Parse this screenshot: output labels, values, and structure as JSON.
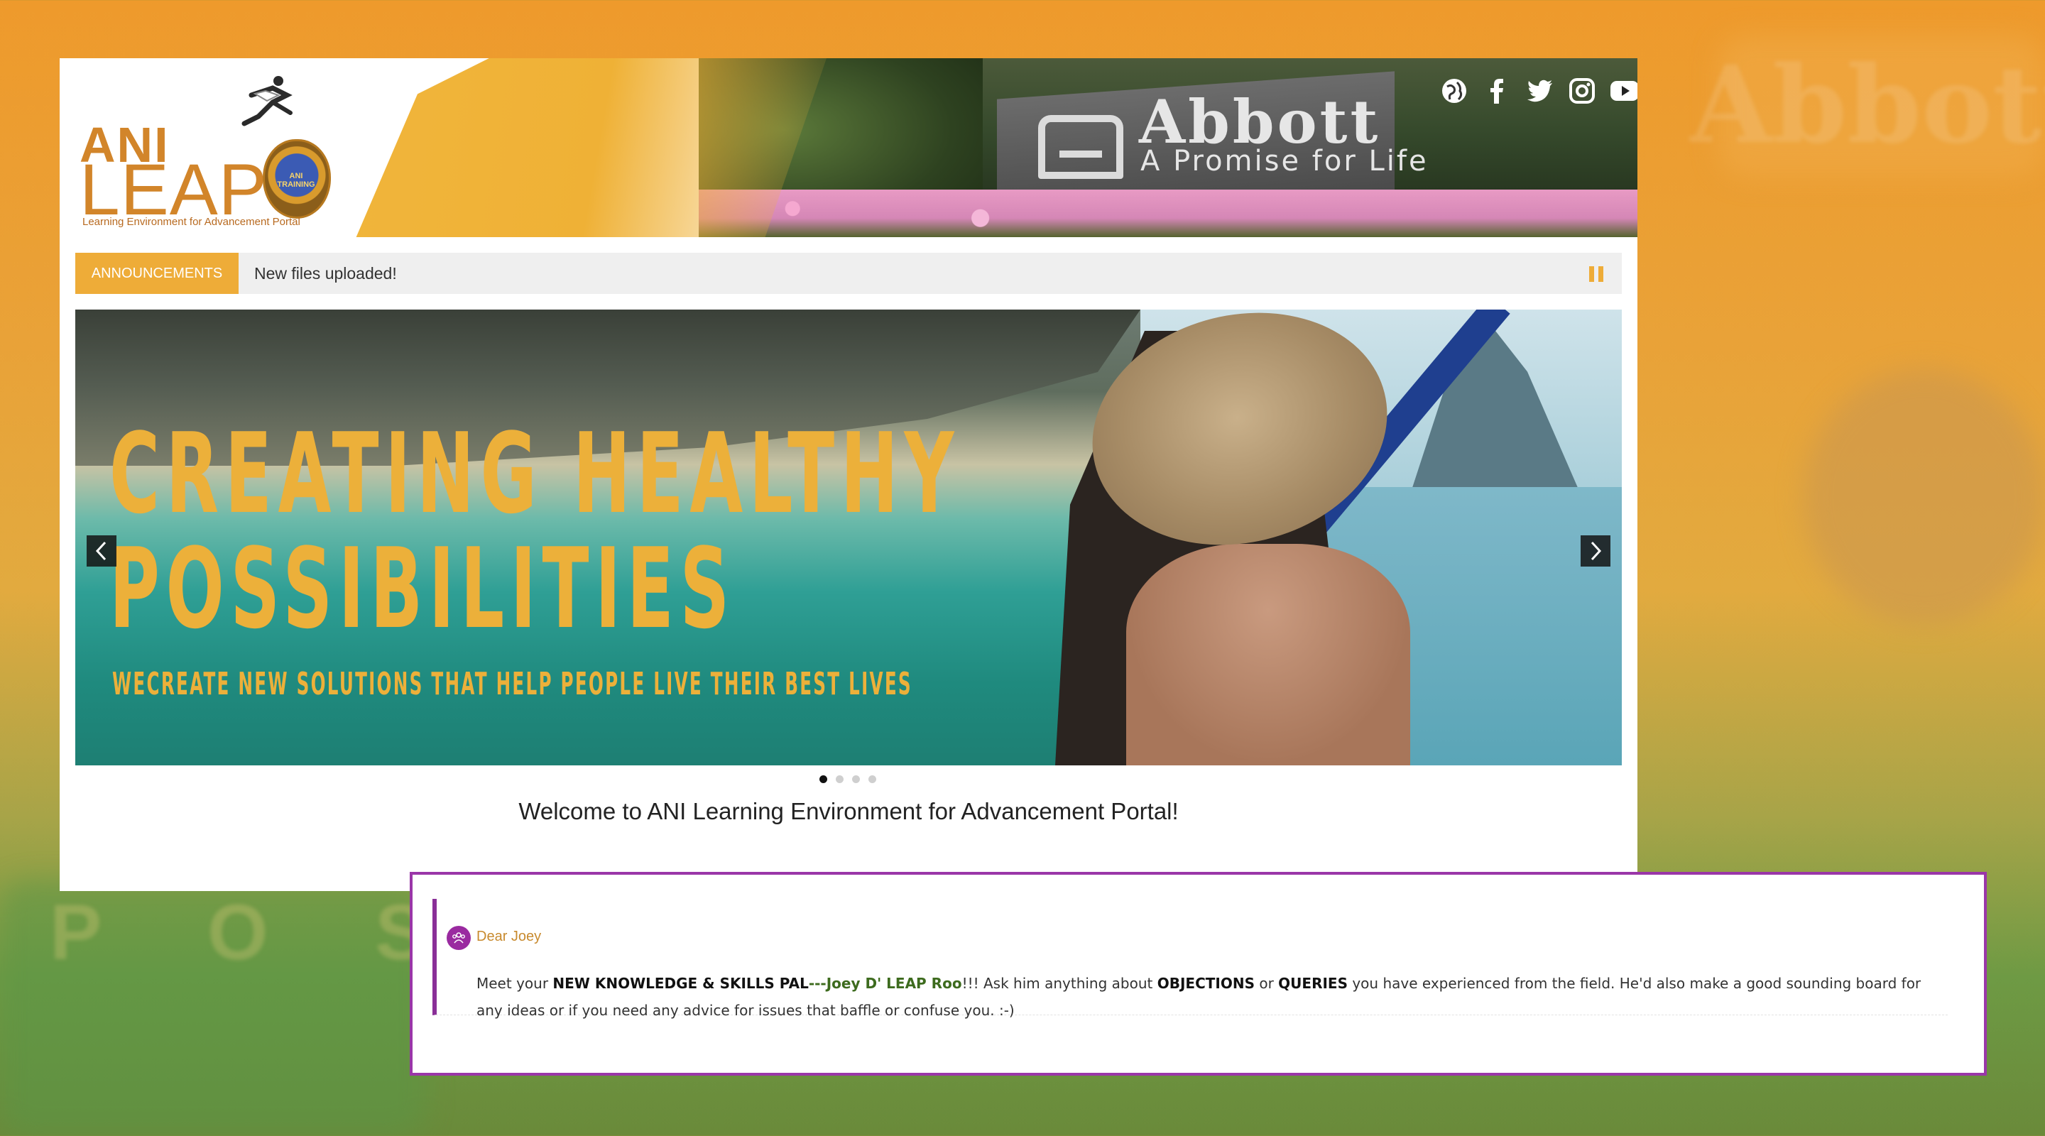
{
  "background": {
    "watermark_text": "Abbott",
    "watermark_letters": "P O S S"
  },
  "header": {
    "logo": {
      "line1": "ANI",
      "line2": "LEAP",
      "subtitle": "Learning Environment for Advancement Portal",
      "badge_text": "ANI TRAINING"
    },
    "banner": {
      "brand": "Abbott",
      "tagline": "A Promise for Life"
    },
    "social_icons": [
      "globe-icon",
      "facebook-icon",
      "twitter-icon",
      "instagram-icon",
      "youtube-icon"
    ]
  },
  "announcements": {
    "label": "ANNOUNCEMENTS",
    "text": "New files uploaded!",
    "paused": false
  },
  "slider": {
    "title_line1": "CREATING HEALTHY",
    "title_line2": "POSSIBILITIES",
    "subtitle": "WECREATE NEW SOLUTIONS THAT HELP PEOPLE LIVE THEIR BEST LIVES",
    "slide_count": 4,
    "active_slide": 1
  },
  "welcome": "Welcome to ANI Learning Environment for Advancement Portal!",
  "post": {
    "title": "Dear Joey",
    "body_parts": {
      "p1": "Meet your ",
      "b1": "NEW KNOWLEDGE & SKILLS PAL",
      "p2": "---",
      "h1": "Joey D' LEAP Roo",
      "p3": "!!!  Ask him anything about ",
      "b2": "OBJECTIONS",
      "p4": " or ",
      "b3": "QUERIES",
      "p5": " you have experienced from the field.  He'd also make a good sounding board for any ideas or if you need any advice for issues that baffle or confuse you.  :-)"
    }
  },
  "colors": {
    "accent": "#eeac38",
    "card_border": "#9a36a8",
    "avatar": "#9a2aa0"
  }
}
